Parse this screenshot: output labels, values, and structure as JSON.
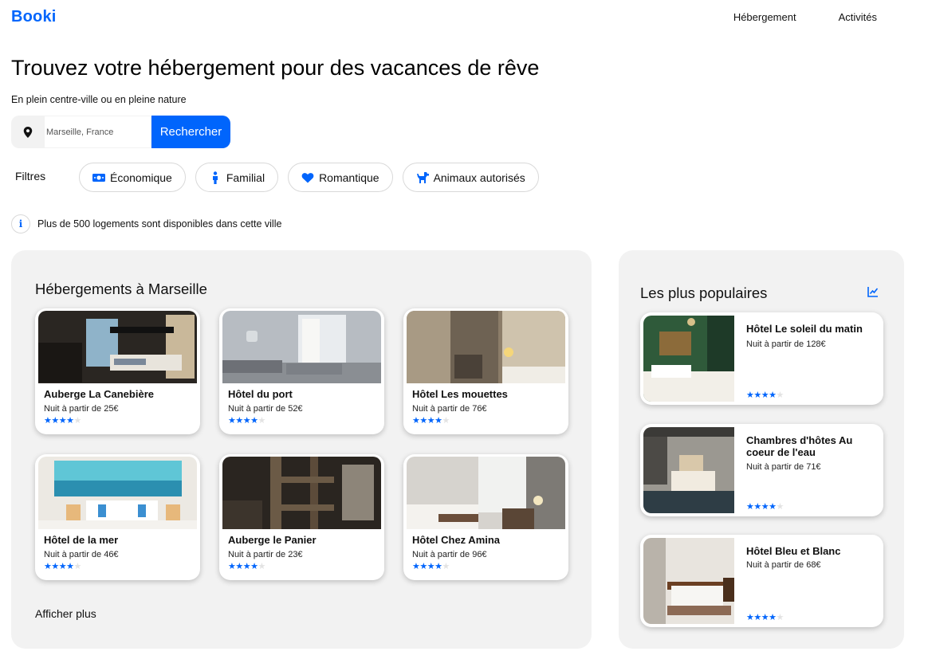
{
  "header": {
    "logo": "Booki",
    "nav": [
      "Hébergement",
      "Activités"
    ]
  },
  "hero": {
    "title": "Trouvez votre hébergement pour des vacances de rêve",
    "subtitle": "En plein centre-ville ou en pleine nature"
  },
  "search": {
    "placeholder": "Marseille, France",
    "button": "Rechercher",
    "icon": "map-pin-icon"
  },
  "filters": {
    "label": "Filtres",
    "items": [
      {
        "label": "Économique",
        "icon": "money-icon"
      },
      {
        "label": "Familial",
        "icon": "person-icon"
      },
      {
        "label": "Romantique",
        "icon": "heart-icon"
      },
      {
        "label": "Animaux autorisés",
        "icon": "dog-icon"
      }
    ]
  },
  "info": {
    "icon": "info-icon",
    "text": "Plus de 500 logements sont disponibles dans cette ville"
  },
  "listing": {
    "title": "Hébergements à Marseille",
    "more": "Afficher plus",
    "cards": [
      {
        "name": "Auberge La Canebière",
        "price": "Nuit à partir de 25€",
        "rating": 4
      },
      {
        "name": "Hôtel du port",
        "price": "Nuit à partir de 52€",
        "rating": 4
      },
      {
        "name": "Hôtel Les mouettes",
        "price": "Nuit à partir de 76€",
        "rating": 4
      },
      {
        "name": "Hôtel de la mer",
        "price": "Nuit à partir de 46€",
        "rating": 4
      },
      {
        "name": "Auberge le Panier",
        "price": "Nuit à partir de 23€",
        "rating": 4
      },
      {
        "name": "Hôtel Chez Amina",
        "price": "Nuit à partir de 96€",
        "rating": 4
      }
    ]
  },
  "popular": {
    "title": "Les plus populaires",
    "icon": "chart-line-icon",
    "cards": [
      {
        "name": "Hôtel Le soleil du matin",
        "price": "Nuit à partir de 128€",
        "rating": 4
      },
      {
        "name": "Chambres d'hôtes Au coeur de l'eau",
        "price": "Nuit à partir de 71€",
        "rating": 4
      },
      {
        "name": "Hôtel Bleu et Blanc",
        "price": "Nuit à partir de 68€",
        "rating": 4
      }
    ]
  },
  "colors": {
    "accent": "#0065FC",
    "panel": "#F2F2F2",
    "star_off": "#E3E3E3"
  }
}
